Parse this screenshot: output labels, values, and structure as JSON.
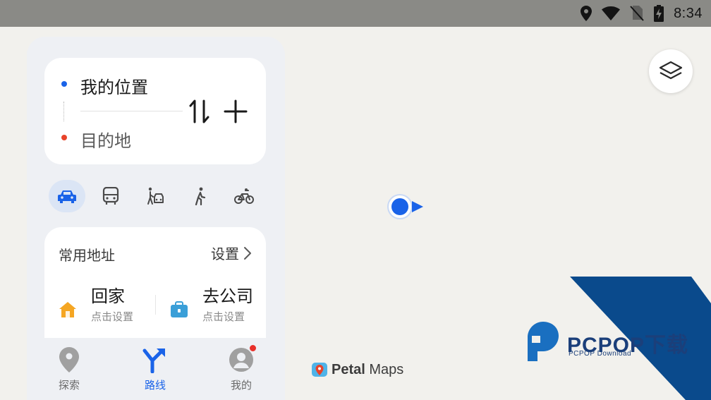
{
  "status_bar": {
    "time": "8:34",
    "icons": [
      "location-icon",
      "wifi-icon",
      "no-sim-icon",
      "battery-charging-icon"
    ]
  },
  "route": {
    "origin": "我的位置",
    "destination": "目的地"
  },
  "transport_modes": [
    {
      "name": "drive",
      "icon": "car-icon",
      "active": true
    },
    {
      "name": "transit",
      "icon": "bus-icon",
      "active": false
    },
    {
      "name": "ride-hailing",
      "icon": "taxi-icon",
      "active": false
    },
    {
      "name": "walk",
      "icon": "walk-icon",
      "active": false
    },
    {
      "name": "bike",
      "icon": "bike-icon",
      "active": false
    }
  ],
  "common_addresses": {
    "title": "常用地址",
    "settings_label": "设置",
    "home": {
      "name": "回家",
      "sub": "点击设置"
    },
    "work": {
      "name": "去公司",
      "sub": "点击设置"
    }
  },
  "bottom_nav": [
    {
      "label": "探索",
      "active": false
    },
    {
      "label": "路线",
      "active": true
    },
    {
      "label": "我的",
      "active": false
    }
  ],
  "map_logo": {
    "bold": "Petal",
    "regular": "Maps"
  },
  "watermark": {
    "text": "PCPOP下载",
    "sub": "PCPOP Download"
  },
  "colors": {
    "accent": "#1a63e8",
    "origin_dot": "#1a63e8",
    "destination_dot": "#e8432a",
    "home_icon": "#f5a623",
    "work_icon": "#3a9fd8",
    "badge": "#e8302a"
  }
}
